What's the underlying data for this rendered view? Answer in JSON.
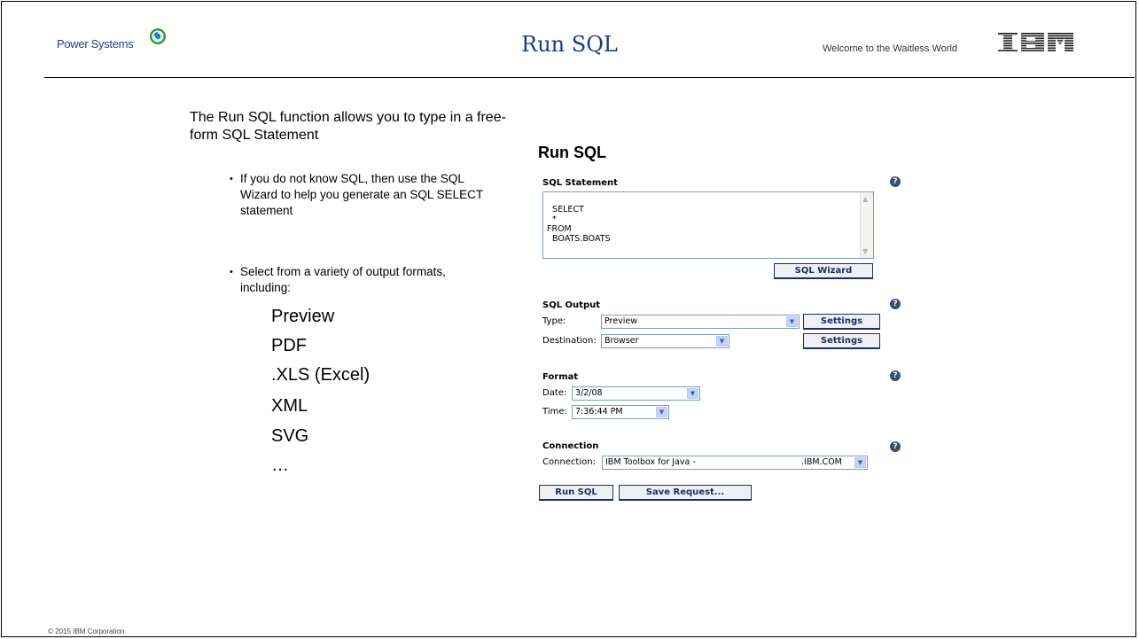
{
  "header": {
    "brand": "Power Systems",
    "title": "Run SQL",
    "tagline": "Welcome to the Waitless World",
    "ibm_logo_text": "IBM"
  },
  "left": {
    "intro": "The Run SQL function allows you to type in a free-form SQL Statement",
    "bullets": [
      "If you do not know SQL, then use the SQL Wizard to help you generate an SQL SELECT statement",
      "Select from a variety of output formats, including:"
    ],
    "formats": [
      "Preview",
      "PDF",
      ".XLS (Excel)",
      "XML",
      "SVG",
      "…"
    ]
  },
  "panel": {
    "title": "Run SQL",
    "sql_statement": {
      "label": "SQL Statement",
      "value": "SELECT\n  *\nFROM\n  BOATS.BOATS",
      "wizard_button": "SQL Wizard"
    },
    "sql_output": {
      "label": "SQL Output",
      "type_label": "Type:",
      "type_value": "Preview",
      "destination_label": "Destination:",
      "destination_value": "Browser",
      "settings_button": "Settings"
    },
    "format": {
      "label": "Format",
      "date_label": "Date:",
      "date_value": "3/2/08",
      "time_label": "Time:",
      "time_value": "7:36:44 PM"
    },
    "connection": {
      "label": "Connection",
      "connection_label": "Connection:",
      "connection_value": "IBM Toolbox for Java -",
      "connection_suffix": ".IBM.COM"
    },
    "buttons": {
      "run": "Run SQL",
      "save": "Save Request..."
    },
    "help_glyph": "?"
  },
  "footer": "© 2015 IBM Corporation",
  "colors": {
    "title_blue": "#1a3a8a",
    "button_border": "#1c2e5e",
    "help_icon": "#3a4f6b"
  }
}
